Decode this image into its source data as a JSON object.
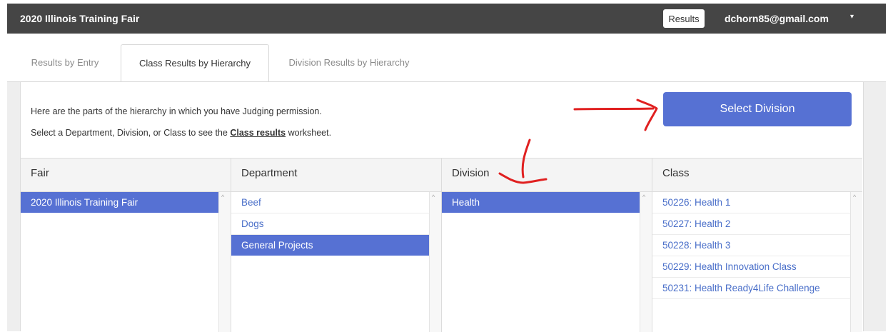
{
  "header": {
    "title": "2020 Illinois Training Fair",
    "results_label": "Results",
    "user_email": "dchorn85@gmail.com",
    "caret": "▾"
  },
  "tabs": [
    {
      "label": "Results by Entry",
      "active": false
    },
    {
      "label": "Class Results by Hierarchy",
      "active": true
    },
    {
      "label": "Division Results by Hierarchy",
      "active": false
    }
  ],
  "intro": {
    "line1": "Here are the parts of the hierarchy in which you have Judging permission.",
    "line2_prefix": "Select a Department, Division, or Class to see the",
    "line2_link": "Class results",
    "line2_suffix": "worksheet."
  },
  "select_division_label": "Select Division",
  "columns": {
    "fair": {
      "header": "Fair",
      "items": [
        "2020 Illinois Training Fair"
      ],
      "selected": 0
    },
    "department": {
      "header": "Department",
      "items": [
        "Beef",
        "Dogs",
        "General Projects"
      ],
      "selected": 2
    },
    "division": {
      "header": "Division",
      "items": [
        "Health"
      ],
      "selected": 0
    },
    "class": {
      "header": "Class",
      "items": [
        "50226: Health 1",
        "50227: Health 2",
        "50228: Health 3",
        "50229: Health Innovation Class",
        "50231: Health Ready4Life Challenge"
      ],
      "selected": -1
    }
  },
  "scroll_up_glyph": "^",
  "colors": {
    "accent": "#5671d3",
    "topbar": "#454545",
    "link": "#4a6fc9",
    "annotation": "#e02020"
  }
}
